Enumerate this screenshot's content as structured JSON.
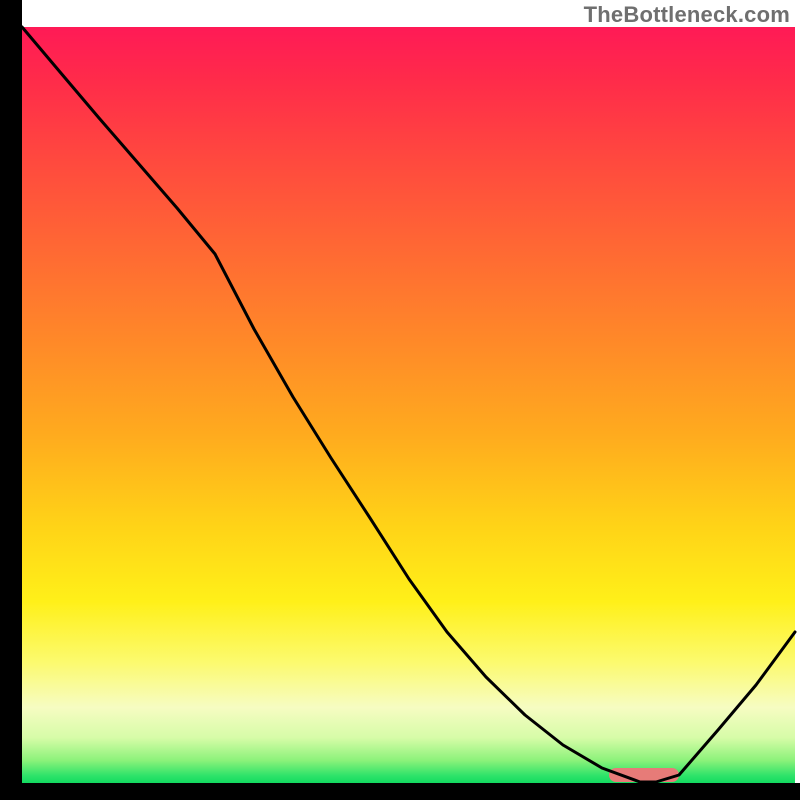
{
  "watermark": "TheBottleneck.com",
  "chart_data": {
    "type": "line",
    "title": "",
    "xlabel": "",
    "ylabel": "",
    "xlim": [
      0,
      100
    ],
    "ylim": [
      0,
      100
    ],
    "background_gradient": {
      "direction": "vertical",
      "stops": [
        {
          "pos": 0,
          "color": "#ff1a56"
        },
        {
          "pos": 18,
          "color": "#ff4a3e"
        },
        {
          "pos": 42,
          "color": "#ff8a28"
        },
        {
          "pos": 66,
          "color": "#ffd317"
        },
        {
          "pos": 84,
          "color": "#fcfa6e"
        },
        {
          "pos": 94,
          "color": "#d7fca8"
        },
        {
          "pos": 100,
          "color": "#12db60"
        }
      ]
    },
    "series": [
      {
        "name": "bottleneck-curve",
        "color": "#000000",
        "x": [
          0,
          5,
          10,
          15,
          20,
          25,
          30,
          35,
          40,
          45,
          50,
          55,
          60,
          65,
          70,
          75,
          80,
          82,
          85,
          90,
          95,
          100
        ],
        "y": [
          100,
          94,
          88,
          82,
          76,
          70,
          60,
          51,
          43,
          35,
          27,
          20,
          14,
          9,
          5,
          2,
          0,
          0,
          1,
          7,
          13,
          20
        ]
      }
    ],
    "optimal_marker": {
      "x_start": 76,
      "x_end": 85,
      "color": "#e77b78"
    },
    "annotations": []
  },
  "axes": {
    "color": "#000000",
    "thickness_px": 25
  }
}
